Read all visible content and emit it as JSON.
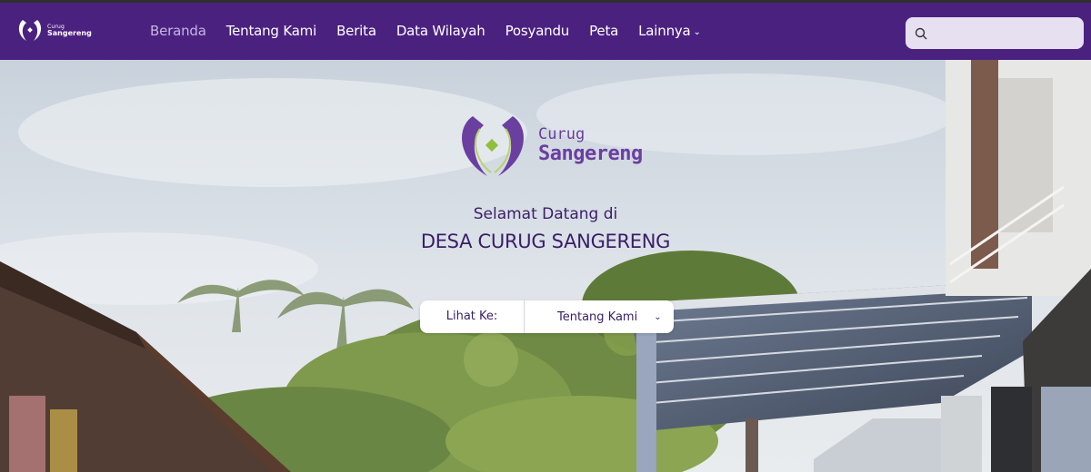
{
  "brand": {
    "logo_word1": "Curug",
    "logo_word2": "Sangereng",
    "primary_color": "#4b2180",
    "accent_color": "#8fc03c"
  },
  "nav": {
    "items": [
      {
        "label": "Beranda",
        "active": true
      },
      {
        "label": "Tentang Kami",
        "active": false
      },
      {
        "label": "Berita",
        "active": false
      },
      {
        "label": "Data Wilayah",
        "active": false
      },
      {
        "label": "Posyandu",
        "active": false
      },
      {
        "label": "Peta",
        "active": false
      },
      {
        "label": "Lainnya",
        "active": false,
        "has_dropdown": true
      }
    ],
    "search": {
      "icon": "search-icon",
      "placeholder": "",
      "value": ""
    }
  },
  "hero": {
    "logo_word1": "Curug",
    "logo_word2": "Sangereng",
    "welcome": "Selamat Datang di",
    "village_name": "DESA CURUG SANGERENG",
    "goto_label": "Lihat Ke:",
    "goto_selected": "Tentang Kami"
  }
}
